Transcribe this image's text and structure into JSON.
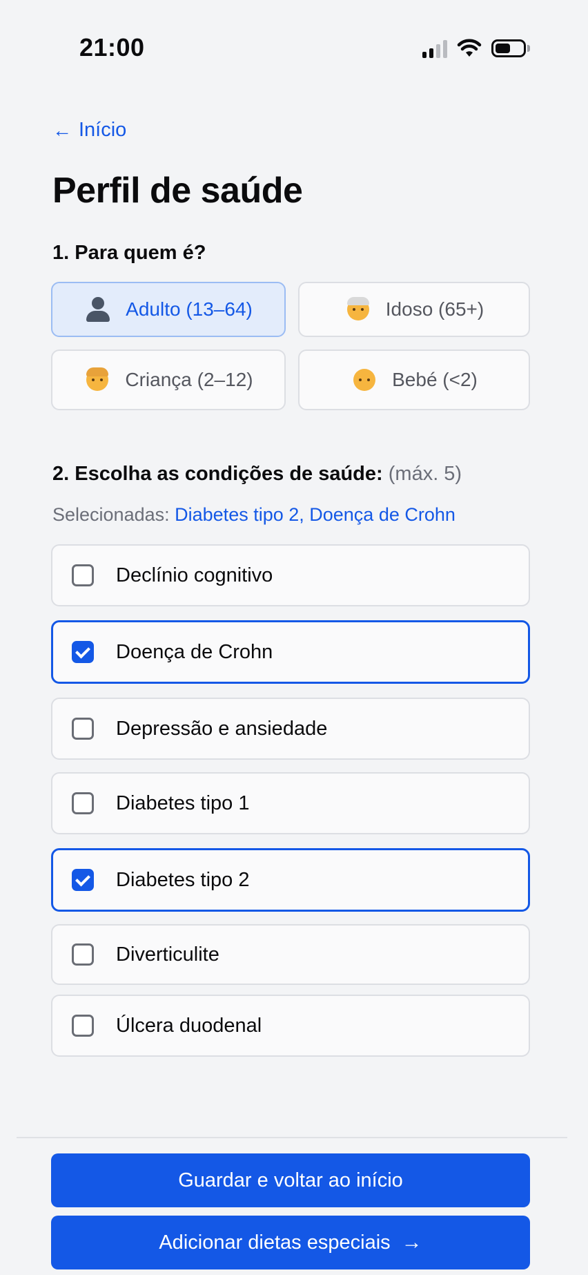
{
  "status_bar": {
    "time": "21:00",
    "battery_level": 0.55
  },
  "nav": {
    "back_label": "Início"
  },
  "page": {
    "title": "Perfil de saúde"
  },
  "profile_section": {
    "question": "1. Para quem é?",
    "options": [
      {
        "label": "Adulto (13–64)",
        "icon": "adult-person-icon",
        "selected": true
      },
      {
        "label": "Idoso (65+)",
        "icon": "older-person-icon",
        "selected": false
      },
      {
        "label": "Criança (2–12)",
        "icon": "child-icon",
        "selected": false
      },
      {
        "label": "Bebé (<2)",
        "icon": "baby-icon",
        "selected": false
      }
    ]
  },
  "conditions_section": {
    "question": "2. Escolha as condições de saúde:",
    "max_note": "(máx. 5)",
    "selected_prefix": "Selecionadas:",
    "selected_values": "Diabetes tipo 2, Doença de Crohn",
    "items": [
      {
        "label": "Declínio cognitivo",
        "checked": false
      },
      {
        "label": "Doença de Crohn",
        "checked": true
      },
      {
        "label": "Depressão e ansiedade",
        "checked": false
      },
      {
        "label": "Diabetes tipo 1",
        "checked": false
      },
      {
        "label": "Diabetes tipo 2",
        "checked": true
      },
      {
        "label": "Diverticulite",
        "checked": false
      },
      {
        "label": "Úlcera duodenal",
        "checked": false
      }
    ]
  },
  "actions": {
    "save_label": "Guardar e voltar ao início",
    "next_label": "Adicionar dietas especiais"
  },
  "colors": {
    "accent": "#1458e6",
    "background": "#f3f4f6",
    "selected_bg": "#e3ecfb"
  }
}
